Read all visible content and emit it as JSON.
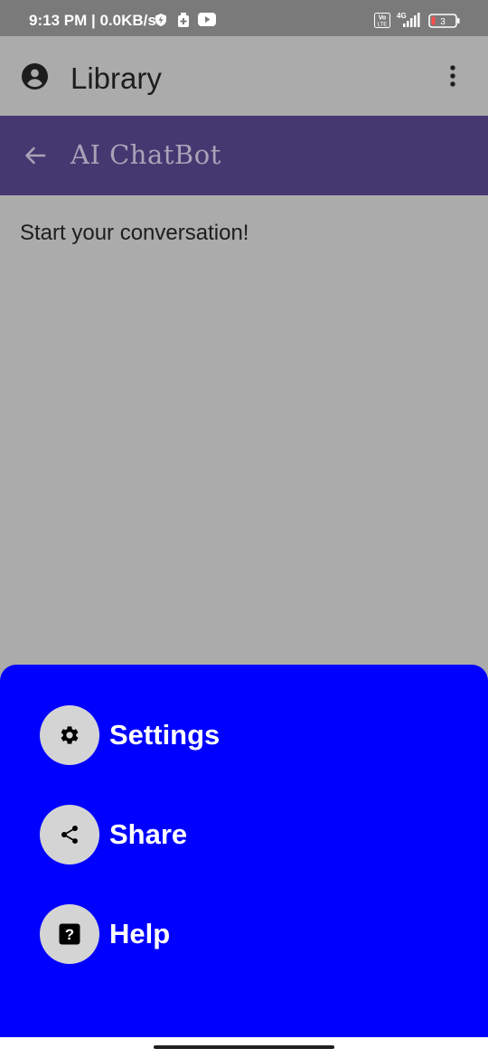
{
  "status_bar": {
    "time_speed": "9:13 PM | 0.0KB/s",
    "volte": "Vo LTE",
    "network": "4G",
    "battery": "3",
    "icons": [
      "bolt-shield-icon",
      "cleaner-icon",
      "youtube-icon",
      "volte-icon",
      "signal-icon",
      "battery-icon"
    ]
  },
  "app_bar": {
    "title": "Library",
    "icons": [
      "account-circle-icon",
      "more-vert-icon"
    ]
  },
  "sub_bar": {
    "title": "AI ChatBot",
    "icons": [
      "arrow-back-icon"
    ]
  },
  "content": {
    "empty_message": "Start your conversation!"
  },
  "sheet": {
    "color": "#0000fe",
    "items": [
      {
        "label": "Settings",
        "icon": "gear-icon"
      },
      {
        "label": "Share",
        "icon": "share-icon"
      },
      {
        "label": "Help",
        "icon": "help-icon"
      }
    ]
  },
  "colors": {
    "scrim": "#ababab",
    "sub_bar": "#453870",
    "status_bar": "#7a7a7a"
  }
}
